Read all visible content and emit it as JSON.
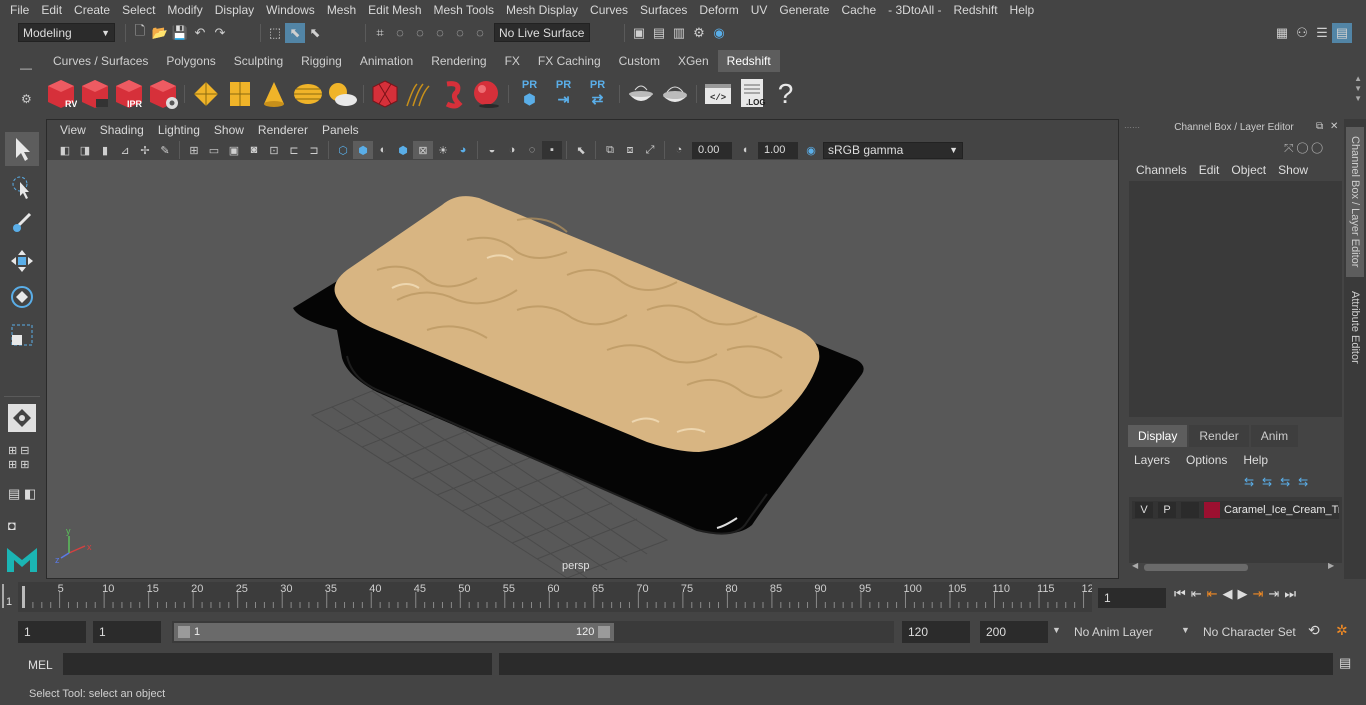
{
  "menubar": [
    "File",
    "Edit",
    "Create",
    "Select",
    "Modify",
    "Display",
    "Windows",
    "Mesh",
    "Edit Mesh",
    "Mesh Tools",
    "Mesh Display",
    "Curves",
    "Surfaces",
    "Deform",
    "UV",
    "Generate",
    "Cache",
    "- 3DtoAll -",
    "Redshift",
    "Help"
  ],
  "statusline": {
    "mode": "Modeling",
    "live_surface": "No Live Surface"
  },
  "shelf_tabs": [
    "Curves / Surfaces",
    "Polygons",
    "Sculpting",
    "Rigging",
    "Animation",
    "Rendering",
    "FX",
    "FX Caching",
    "Custom",
    "XGen",
    "Redshift"
  ],
  "shelf_active": "Redshift",
  "shelf_icon_labels": {
    "rv": "RV",
    "ipr": "IPR",
    "pr": "PR",
    "log": ".LOG",
    "help": "?"
  },
  "viewport": {
    "menu": [
      "View",
      "Shading",
      "Lighting",
      "Show",
      "Renderer",
      "Panels"
    ],
    "near_value": "0.00",
    "far_value": "1.00",
    "color_space": "sRGB gamma",
    "camera_label": "persp",
    "axis_labels": {
      "x": "x",
      "y": "y",
      "z": "z"
    }
  },
  "channel_box": {
    "title": "Channel Box / Layer Editor",
    "menu": [
      "Channels",
      "Edit",
      "Object",
      "Show"
    ]
  },
  "layer_editor": {
    "tabs": [
      "Display",
      "Render",
      "Anim"
    ],
    "active_tab": "Display",
    "menu": [
      "Layers",
      "Options",
      "Help"
    ],
    "layers": [
      {
        "v": "V",
        "p": "P",
        "color": "#9b1030",
        "name": "Caramel_Ice_Cream_Tra"
      }
    ]
  },
  "side_tabs": {
    "channel_box": "Channel Box / Layer Editor",
    "attribute_editor": "Attribute Editor"
  },
  "timeline": {
    "ticks": [
      "5",
      "10",
      "15",
      "20",
      "25",
      "30",
      "35",
      "40",
      "45",
      "50",
      "55",
      "60",
      "65",
      "70",
      "75",
      "80",
      "85",
      "90",
      "95",
      "100",
      "105",
      "110",
      "115",
      "12"
    ],
    "start_marker": "1",
    "current_frame": "1"
  },
  "range": {
    "start": "1",
    "playback_start": "1",
    "slider_start": "1",
    "slider_end": "120",
    "playback_end": "120",
    "end": "200",
    "anim_layer": "No Anim Layer",
    "character_set": "No Character Set"
  },
  "mel": {
    "label": "MEL"
  },
  "help_line": "Select Tool: select an object",
  "colors": {
    "background": "#444444",
    "viewport_bg": "#585858",
    "ice_cream": "#d8b582",
    "container": "#050505",
    "accent_blue": "#5aaee8",
    "redshift_red": "#d6303a",
    "layer_color": "#9b1030"
  }
}
